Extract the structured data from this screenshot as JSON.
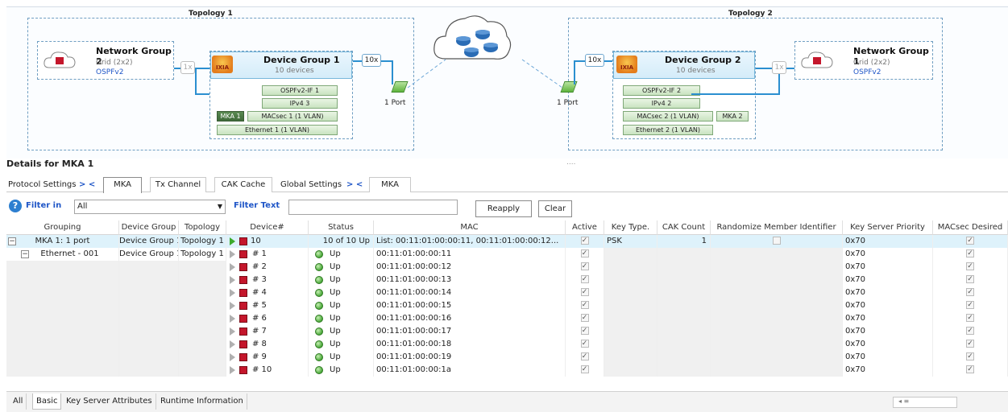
{
  "topology1": {
    "title": "Topology 1",
    "network_group": {
      "title": "Network Group 2",
      "sub": "Grid (2x2)",
      "protocol": "OSPFv2"
    },
    "multiplier_ng": "1x",
    "device_group": {
      "title": "Device Group 1",
      "sub": "10 devices"
    },
    "multiplier_dg": "10x",
    "stack": {
      "ospf": "OSPFv2-IF 1",
      "ipv4": "IPv4 3",
      "mka": "MKA 1",
      "macsec": "MACsec 1 (1 VLAN)",
      "ethernet": "Ethernet 1 (1 VLAN)"
    },
    "port_label": "1 Port"
  },
  "topology2": {
    "title": "Topology 2",
    "network_group": {
      "title": "Network Group 1",
      "sub": "Grid (2x2)",
      "protocol": "OSPFv2"
    },
    "multiplier_ng": "1x",
    "device_group": {
      "title": "Device Group 2",
      "sub": "10 devices"
    },
    "multiplier_dg": "10x",
    "stack": {
      "ospf": "OSPFv2-IF 2",
      "ipv4": "IPv4 2",
      "mka": "MKA 2",
      "macsec": "MACsec 2 (1 VLAN)",
      "ethernet": "Ethernet 2 (1 VLAN)"
    },
    "port_label": "1 Port"
  },
  "ixia_text": "IXIA",
  "splitter_dots": "....",
  "details_title": "Details for MKA 1",
  "tabs": {
    "protocol_settings": "Protocol Settings",
    "nav_arrows": "> <",
    "mka": "MKA",
    "tx_channel": "Tx Channel",
    "cak_cache": "CAK Cache",
    "global_settings": "Global Settings",
    "global_mka": "MKA"
  },
  "filter": {
    "filter_in_label": "Filter in",
    "filter_in_value": "All",
    "filter_text_label": "Filter Text",
    "filter_text_value": "",
    "reapply": "Reapply",
    "clear": "Clear"
  },
  "grid": {
    "columns": [
      "Grouping",
      "Device Group",
      "Topology",
      "Device#",
      "Status",
      "MAC",
      "Active",
      "Key Type.",
      "CAK Count",
      "Randomize Member Identifier",
      "Key Server Priority",
      "MACsec Desired"
    ],
    "summary_row": {
      "grouping": "MKA 1: 1 port",
      "device_group": "Device Group 1",
      "topology": "Topology 1",
      "device": "10",
      "status": "10 of 10 Up",
      "mac": "List: 00:11:01:00:00:11, 00:11:01:00:00:12...",
      "key_type": "PSK",
      "cak_count": "1",
      "key_server_priority": "0x70"
    },
    "sub_row": {
      "grouping": "Ethernet - 001",
      "device_group": "Device Group 1",
      "topology": "Topology 1"
    },
    "devices": [
      {
        "device": "# 1",
        "status": "Up",
        "mac": "00:11:01:00:00:11",
        "priority": "0x70"
      },
      {
        "device": "# 2",
        "status": "Up",
        "mac": "00:11:01:00:00:12",
        "priority": "0x70"
      },
      {
        "device": "# 3",
        "status": "Up",
        "mac": "00:11:01:00:00:13",
        "priority": "0x70"
      },
      {
        "device": "# 4",
        "status": "Up",
        "mac": "00:11:01:00:00:14",
        "priority": "0x70"
      },
      {
        "device": "# 5",
        "status": "Up",
        "mac": "00:11:01:00:00:15",
        "priority": "0x70"
      },
      {
        "device": "# 6",
        "status": "Up",
        "mac": "00:11:01:00:00:16",
        "priority": "0x70"
      },
      {
        "device": "# 7",
        "status": "Up",
        "mac": "00:11:01:00:00:17",
        "priority": "0x70"
      },
      {
        "device": "# 8",
        "status": "Up",
        "mac": "00:11:01:00:00:18",
        "priority": "0x70"
      },
      {
        "device": "# 9",
        "status": "Up",
        "mac": "00:11:01:00:00:19",
        "priority": "0x70"
      },
      {
        "device": "# 10",
        "status": "Up",
        "mac": "00:11:01:00:00:1a",
        "priority": "0x70"
      }
    ],
    "check_mark": "✓"
  },
  "bottom_tabs": [
    "All",
    "Basic",
    "Key Server Attributes",
    "Runtime Information"
  ],
  "scroll_glyph": "◂  ≡"
}
